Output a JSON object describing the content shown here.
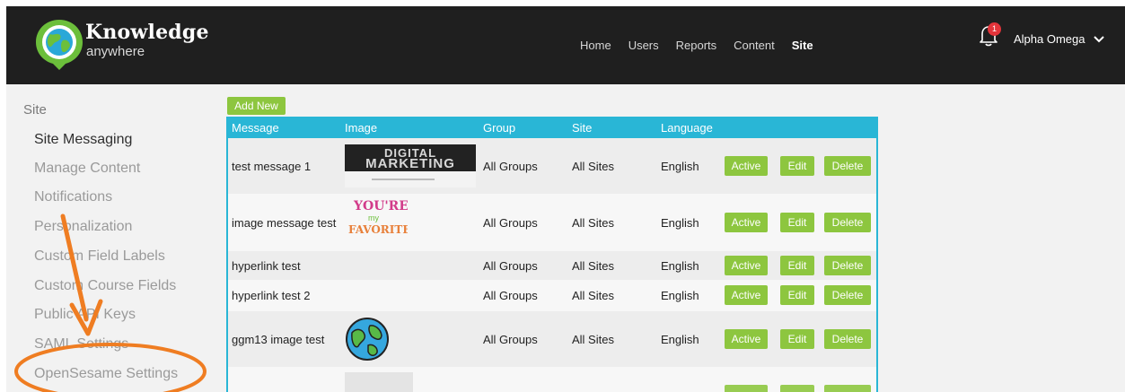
{
  "brand": {
    "name": "Knowledge",
    "sub": "anywhere"
  },
  "nav": {
    "items": [
      "Home",
      "Users",
      "Reports",
      "Content",
      "Site"
    ],
    "active": "Site"
  },
  "notifications": {
    "count": "1"
  },
  "user": {
    "name": "Alpha Omega"
  },
  "sidebar": {
    "heading": "Site",
    "items": [
      "Site Messaging",
      "Manage Content",
      "Notifications",
      "Personalization",
      "Custom Field Labels",
      "Custom Course Fields",
      "Public API Keys",
      "SAML Settings",
      "OpenSesame Settings"
    ]
  },
  "toolbar": {
    "add_label": "Add New"
  },
  "table": {
    "headers": [
      "Message",
      "Image",
      "Group",
      "Site",
      "Language"
    ],
    "rows": [
      {
        "message": "test message 1",
        "image": "digital-marketing-thumbnail",
        "image_text": [
          "DIGITAL",
          "MARKETING"
        ],
        "group": "All Groups",
        "site": "All Sites",
        "language": "English"
      },
      {
        "message": "image message test",
        "image": "youre-my-favorite-thumbnail",
        "image_text": [
          "YOU'RE",
          "my",
          "FAVORITE"
        ],
        "group": "All Groups",
        "site": "All Sites",
        "language": "English"
      },
      {
        "message": "hyperlink test",
        "image": "",
        "group": "All Groups",
        "site": "All Sites",
        "language": "English"
      },
      {
        "message": "hyperlink test 2",
        "image": "",
        "group": "All Groups",
        "site": "All Sites",
        "language": "English"
      },
      {
        "message": "ggm13 image test",
        "image": "globe-thumbnail",
        "group": "All Groups",
        "site": "All Sites",
        "language": "English"
      }
    ],
    "actions": {
      "active": "Active",
      "edit": "Edit",
      "delete": "Delete"
    }
  },
  "colors": {
    "header_bg": "#1f1f1f",
    "table_header": "#29b6d6",
    "button_green": "#8dc63f",
    "annotation_orange": "#ef7d22",
    "badge_red": "#e2343a"
  }
}
